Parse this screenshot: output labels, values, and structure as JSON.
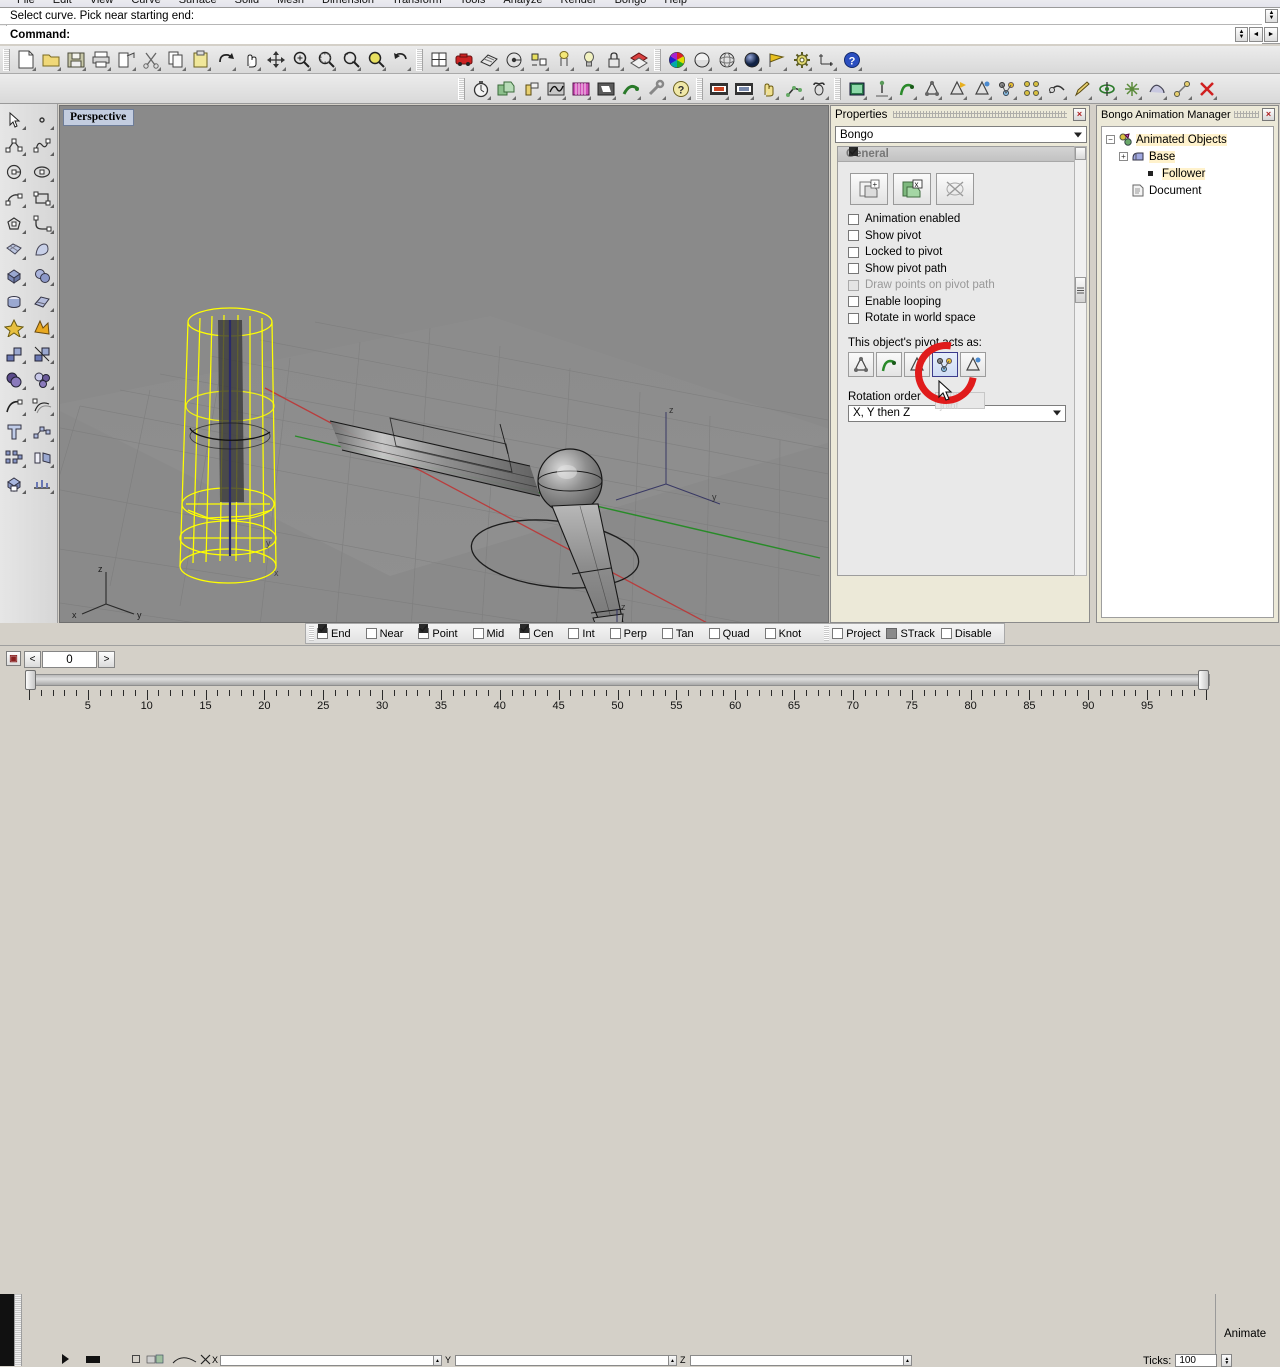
{
  "app": {
    "menu": [
      "File",
      "Edit",
      "View",
      "Curve",
      "Surface",
      "Solid",
      "Mesh",
      "Dimension",
      "Transform",
      "Tools",
      "Analyze",
      "Render",
      "Bongo",
      "Help"
    ]
  },
  "command": {
    "history": "Select curve. Pick near starting end:",
    "prompt_label": "Command:",
    "prompt_value": "",
    "prev_label": "◄",
    "next_label": "►"
  },
  "toolbar_standard": [
    {
      "name": "new-file-icon",
      "title": "New"
    },
    {
      "name": "open-file-icon",
      "title": "Open"
    },
    {
      "name": "save-file-icon",
      "title": "Save"
    },
    {
      "name": "print-icon",
      "title": "Print"
    },
    {
      "name": "export-icon",
      "title": "Export"
    },
    {
      "name": "cut-icon",
      "title": "Cut"
    },
    {
      "name": "copy-icon",
      "title": "Copy"
    },
    {
      "name": "paste-icon",
      "title": "Paste"
    },
    {
      "name": "undo-icon",
      "title": "Undo"
    },
    {
      "name": "pan-icon",
      "title": "Pan"
    },
    {
      "name": "move-icon",
      "title": "Move"
    },
    {
      "name": "zoom-in-icon",
      "title": "Zoom in"
    },
    {
      "name": "zoom-window-icon",
      "title": "Zoom window"
    },
    {
      "name": "zoom-extents-icon",
      "title": "Zoom extents"
    },
    {
      "name": "zoom-selected-icon",
      "title": "Zoom selected"
    },
    {
      "name": "rotate-view-icon",
      "title": "Rotate view"
    },
    {
      "name": "viewport-layout-icon",
      "title": "Viewport layout"
    },
    {
      "name": "four-view-icon",
      "title": "4 viewports"
    },
    {
      "name": "render-icon",
      "title": "Render"
    },
    {
      "name": "mesh-icon",
      "title": "Render mesh"
    },
    {
      "name": "named-view-icon",
      "title": "Named view"
    },
    {
      "name": "object-properties-icon",
      "title": "Object properties"
    },
    {
      "name": "light-icon",
      "title": "Light"
    },
    {
      "name": "lock-icon",
      "title": "Lock"
    },
    {
      "name": "layer-icon",
      "title": "Layers"
    },
    {
      "name": "color-wheel-icon",
      "title": "Color"
    },
    {
      "name": "shade-icon",
      "title": "Shaded view"
    },
    {
      "name": "ghosted-icon",
      "title": "Ghosted view"
    },
    {
      "name": "rendered-icon",
      "title": "Rendered view"
    },
    {
      "name": "flag-icon",
      "title": "Flag"
    },
    {
      "name": "options-gear-icon",
      "title": "Options"
    },
    {
      "name": "dimension-icon",
      "title": "Dimension"
    },
    {
      "name": "help-icon",
      "title": "Help"
    }
  ],
  "toolbar_bongo": [
    {
      "name": "stopwatch-icon",
      "title": "Animate"
    },
    {
      "name": "add-object-icon",
      "title": "Add object"
    },
    {
      "name": "keyframe-icon",
      "title": "Keyframe"
    },
    {
      "name": "curve-edit-icon",
      "title": "Curve editor"
    },
    {
      "name": "film-icon",
      "title": "Timeline"
    },
    {
      "name": "render-anim-icon",
      "title": "Render animation"
    },
    {
      "name": "snake-path-icon",
      "title": "Path animation"
    },
    {
      "name": "tools-icon",
      "title": "Tools"
    },
    {
      "name": "help-bongo-icon",
      "title": "Bongo help"
    },
    {
      "name": "car-film-icon",
      "title": "Animation preview"
    },
    {
      "name": "camera-film-icon",
      "title": "Camera animation"
    },
    {
      "name": "hand-icon",
      "title": "Constraints"
    },
    {
      "name": "ik-chain-icon",
      "title": "IK chain"
    },
    {
      "name": "bull-icon",
      "title": "Object"
    },
    {
      "name": "window-icon",
      "title": "Window"
    },
    {
      "name": "pivot-point-icon",
      "title": "Pivot point"
    },
    {
      "name": "pivot-curve-icon",
      "title": "Pivot along curve"
    },
    {
      "name": "pivot-axis-icon",
      "title": "Pivot axis"
    },
    {
      "name": "pivot-move-icon",
      "title": "Pivot move"
    },
    {
      "name": "pivot-rot-icon",
      "title": "Pivot rotate"
    },
    {
      "name": "pivot-chain-icon",
      "title": "Pivot chain"
    },
    {
      "name": "ik-solver-icon",
      "title": "IK solver"
    },
    {
      "name": "constraint-icon",
      "title": "Constraint"
    },
    {
      "name": "pencil-icon",
      "title": "Edit"
    },
    {
      "name": "rotate-obj-icon",
      "title": "Rotate object"
    },
    {
      "name": "scale-obj-icon",
      "title": "Scale object"
    },
    {
      "name": "morph-icon",
      "title": "Morph"
    },
    {
      "name": "link-icon",
      "title": "Link"
    },
    {
      "name": "delete-anim-icon",
      "title": "Delete animation"
    }
  ],
  "left_palette": [
    {
      "name": "select-arrow-icon"
    },
    {
      "name": "point-icon"
    },
    {
      "name": "polyline-icon"
    },
    {
      "name": "curve-icon"
    },
    {
      "name": "circle-icon"
    },
    {
      "name": "ellipse-icon"
    },
    {
      "name": "arc-icon"
    },
    {
      "name": "rectangle-icon"
    },
    {
      "name": "polygon-icon"
    },
    {
      "name": "fillet-curve-icon"
    },
    {
      "name": "surface-icon"
    },
    {
      "name": "loft-icon"
    },
    {
      "name": "box-icon"
    },
    {
      "name": "sphere-icon"
    },
    {
      "name": "cylinder-icon"
    },
    {
      "name": "extrude-icon"
    },
    {
      "name": "explode-icon"
    },
    {
      "name": "boolean-icon"
    },
    {
      "name": "join-icon"
    },
    {
      "name": "trim-icon"
    },
    {
      "name": "boolean-union-icon"
    },
    {
      "name": "boolean-split-icon"
    },
    {
      "name": "blend-curve-icon"
    },
    {
      "name": "offset-curve-icon"
    },
    {
      "name": "text-icon"
    },
    {
      "name": "control-point-icon"
    },
    {
      "name": "array-icon"
    },
    {
      "name": "mirror-icon"
    },
    {
      "name": "render-box-icon"
    },
    {
      "name": "dimension-tool-icon"
    }
  ],
  "viewport": {
    "title": "Perspective",
    "axis_labels": [
      "z",
      "y",
      "x"
    ],
    "gumball_z": "z",
    "gumball_y": "y",
    "gumball_x": "x"
  },
  "properties": {
    "title": "Properties",
    "close_label": "×",
    "page_selector": "Bongo",
    "group_title": "General",
    "buttons": [
      {
        "name": "add-animation-button",
        "label": ""
      },
      {
        "name": "remove-animation-button",
        "label": ""
      },
      {
        "name": "delete-keyframes-button",
        "label": ""
      }
    ],
    "checkboxes": [
      {
        "label": "Animation enabled",
        "checked": true,
        "disabled": false
      },
      {
        "label": "Show pivot",
        "checked": true,
        "disabled": false
      },
      {
        "label": "Locked to pivot",
        "checked": true,
        "disabled": false
      },
      {
        "label": "Show pivot path",
        "checked": false,
        "disabled": false
      },
      {
        "label": "Draw points on pivot path",
        "checked": false,
        "disabled": true
      },
      {
        "label": "Enable looping",
        "checked": false,
        "disabled": false
      },
      {
        "label": "Rotate in world space",
        "checked": false,
        "disabled": false
      }
    ],
    "pivot_label": "This object's pivot acts as:",
    "pivot_buttons": [
      {
        "name": "pivot-free-button",
        "selected": false
      },
      {
        "name": "pivot-curve-button",
        "selected": false
      },
      {
        "name": "pivot-slider-button",
        "selected": false
      },
      {
        "name": "pivot-hinge-button",
        "selected": true
      },
      {
        "name": "pivot-balljoint-button",
        "selected": false
      }
    ],
    "tooltip": "Hinge joint",
    "rotation_order_label": "Rotation order",
    "rotation_order_value": "X, Y then Z"
  },
  "bongo_manager": {
    "title": "Bongo Animation Manager",
    "close_label": "×",
    "tree": [
      {
        "label": "Animated Objects",
        "depth": 0,
        "expander": "−",
        "icon": "animated-objects-icon"
      },
      {
        "label": "Base",
        "depth": 1,
        "expander": "+",
        "icon": "base-object-icon"
      },
      {
        "label": "Follower",
        "depth": 2,
        "expander": "",
        "icon": "follower-object-icon"
      },
      {
        "label": "Document",
        "depth": 1,
        "expander": "",
        "icon": "document-icon"
      }
    ]
  },
  "osnap": [
    {
      "label": "End",
      "checked": true
    },
    {
      "label": "Near",
      "checked": false
    },
    {
      "label": "Point",
      "checked": true
    },
    {
      "label": "Mid",
      "checked": false
    },
    {
      "label": "Cen",
      "checked": true
    },
    {
      "label": "Int",
      "checked": false
    },
    {
      "label": "Perp",
      "checked": false
    },
    {
      "label": "Tan",
      "checked": false
    },
    {
      "label": "Quad",
      "checked": false
    },
    {
      "label": "Knot",
      "checked": false
    },
    {
      "label": "Project",
      "checked": false
    },
    {
      "label": "STrack",
      "checked": false,
      "gray": true
    },
    {
      "label": "Disable",
      "checked": false
    }
  ],
  "timeline": {
    "current_frame": "0",
    "prev_label": "<",
    "next_label": ">",
    "icon_label": "▣",
    "tick_start": 0,
    "tick_end": 100,
    "label_step": 5,
    "labels": [
      5,
      10,
      15,
      20,
      25,
      30,
      35,
      40,
      45,
      50,
      55,
      60,
      65,
      70,
      75,
      80,
      85,
      90,
      95
    ],
    "animate_label": "Animate",
    "ticks_label": "Ticks:",
    "ticks_value": "100",
    "slider_position": 0
  },
  "bottom_bar": {
    "x_label": "X",
    "y_label": "Y",
    "z_label": "Z",
    "x_value": "",
    "y_value": "",
    "z_value": ""
  },
  "colors": {
    "selection_yellow": "#ffff00",
    "annotation_red": "#e01b1b",
    "viewport_bg": "#8a8a8a",
    "panel_bg": "#ece9d8",
    "axis_green": "#1e8c1e",
    "axis_red": "#c03030"
  }
}
